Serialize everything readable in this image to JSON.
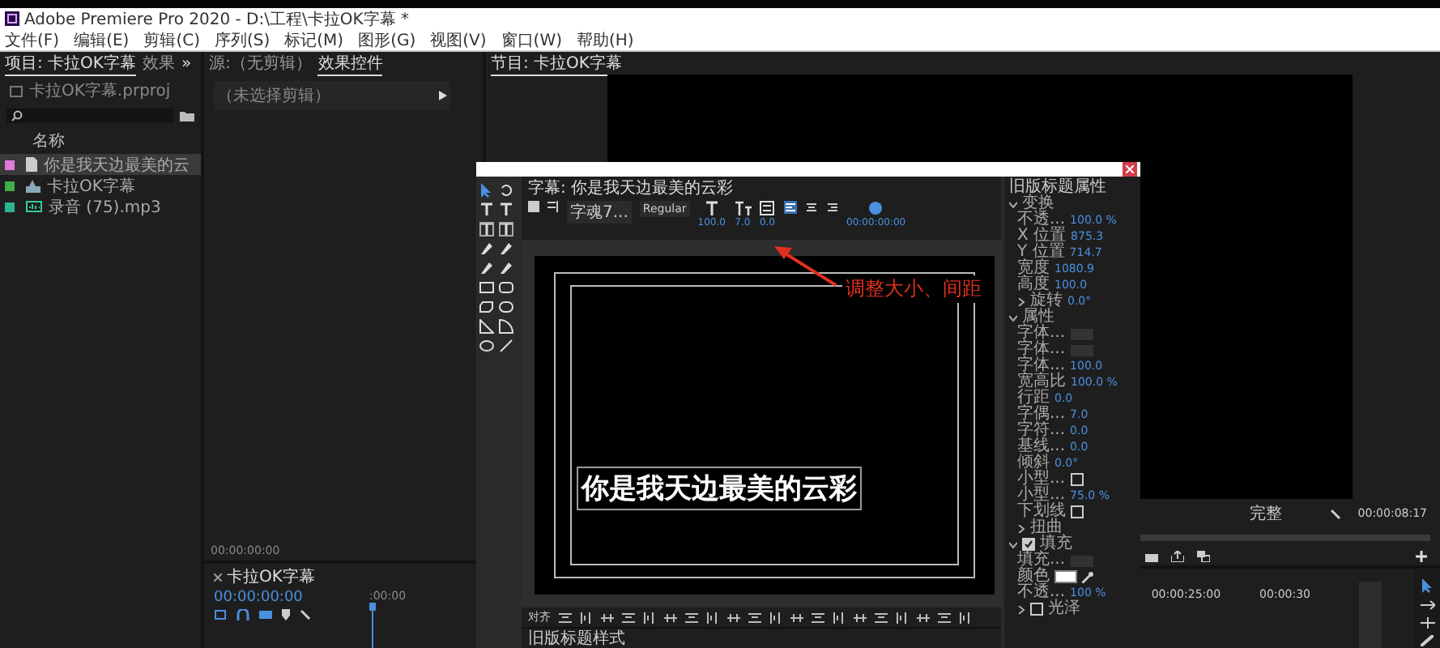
{
  "window": {
    "title": "Adobe Premiere Pro 2020 - D:\\工程\\卡拉OK字幕 *"
  },
  "menu": [
    "文件(F)",
    "编辑(E)",
    "剪辑(C)",
    "序列(S)",
    "标记(M)",
    "图形(G)",
    "视图(V)",
    "窗口(W)",
    "帮助(H)"
  ],
  "project_panel": {
    "tabs": [
      {
        "label": "项目: 卡拉OK字幕",
        "selected": true
      },
      {
        "label": "效果",
        "selected": false
      }
    ],
    "overflow": "»",
    "file": "卡拉OK字幕.prproj",
    "column": "名称",
    "items": [
      {
        "name": "你是我天边最美的云",
        "color": "#e07ad8",
        "kind": "title",
        "selected": true
      },
      {
        "name": "卡拉OK字幕",
        "color": "#3fae49",
        "kind": "sequence",
        "selected": false
      },
      {
        "name": "录音 (75).mp3",
        "color": "#2bb38f",
        "kind": "audio",
        "selected": false
      }
    ]
  },
  "effect_panel": {
    "tabs": [
      {
        "label": "源:（无剪辑）",
        "selected": false
      },
      {
        "label": "效果控件",
        "selected": true
      }
    ],
    "message": "（未选择剪辑）",
    "timecode": "00:00:00:00"
  },
  "timeline": {
    "title": "卡拉OK字幕",
    "timecode": "00:00:00:00",
    "ruler": ":00:00"
  },
  "program": {
    "title": "节目: 卡拉OK字幕",
    "zoom": "完整",
    "timecode": "00:00:08:17",
    "ruler": [
      "00:00:25:00",
      "00:00:30"
    ]
  },
  "titler": {
    "tab": "字幕: 你是我天边最美的云彩",
    "font": "字魂7...",
    "style": "Regular",
    "readings": [
      "100.0",
      "7.0",
      "0.0"
    ],
    "timecode": "00:00:00:00",
    "caption": "你是我天边最美的云彩",
    "annotation": "调整大小、间距",
    "align_label": "对齐",
    "styles_label": "旧版标题样式",
    "properties": {
      "title": "旧版标题属性",
      "rows": [
        {
          "kind": "section",
          "label": "变换",
          "expanded": true
        },
        {
          "kind": "value",
          "label": "不透...",
          "value": "100.0 %"
        },
        {
          "kind": "value",
          "label": "X 位置",
          "value": "875.3"
        },
        {
          "kind": "value",
          "label": "Y 位置",
          "value": "714.7"
        },
        {
          "kind": "value",
          "label": "宽度",
          "value": "1080.9"
        },
        {
          "kind": "value",
          "label": "高度",
          "value": "100.0"
        },
        {
          "kind": "subvalue",
          "label": "旋转",
          "value": "0.0°",
          "expanded": false
        },
        {
          "kind": "section",
          "label": "属性",
          "expanded": true
        },
        {
          "kind": "dropdown",
          "label": "字体..."
        },
        {
          "kind": "dropdown",
          "label": "字体..."
        },
        {
          "kind": "value",
          "label": "字体...",
          "value": "100.0"
        },
        {
          "kind": "value",
          "label": "宽高比",
          "value": "100.0 %"
        },
        {
          "kind": "value",
          "label": "行距",
          "value": "0.0"
        },
        {
          "kind": "value",
          "label": "字偶...",
          "value": "7.0"
        },
        {
          "kind": "value",
          "label": "字符...",
          "value": "0.0"
        },
        {
          "kind": "value",
          "label": "基线...",
          "value": "0.0"
        },
        {
          "kind": "value",
          "label": "倾斜",
          "value": "0.0°"
        },
        {
          "kind": "check",
          "label": "小型...",
          "checked": false
        },
        {
          "kind": "value",
          "label": "小型...",
          "value": "75.0 %"
        },
        {
          "kind": "check",
          "label": "下划线",
          "checked": false
        },
        {
          "kind": "group",
          "label": "扭曲",
          "expanded": false
        },
        {
          "kind": "section",
          "label": "填充",
          "expanded": true,
          "checked": true
        },
        {
          "kind": "dropdown",
          "label": "填充..."
        },
        {
          "kind": "swatch",
          "label": "颜色",
          "color": "#ffffff"
        },
        {
          "kind": "value",
          "label": "不透...",
          "value": "100 %"
        },
        {
          "kind": "group",
          "label": "光泽",
          "expanded": false,
          "checked": false
        }
      ]
    }
  }
}
